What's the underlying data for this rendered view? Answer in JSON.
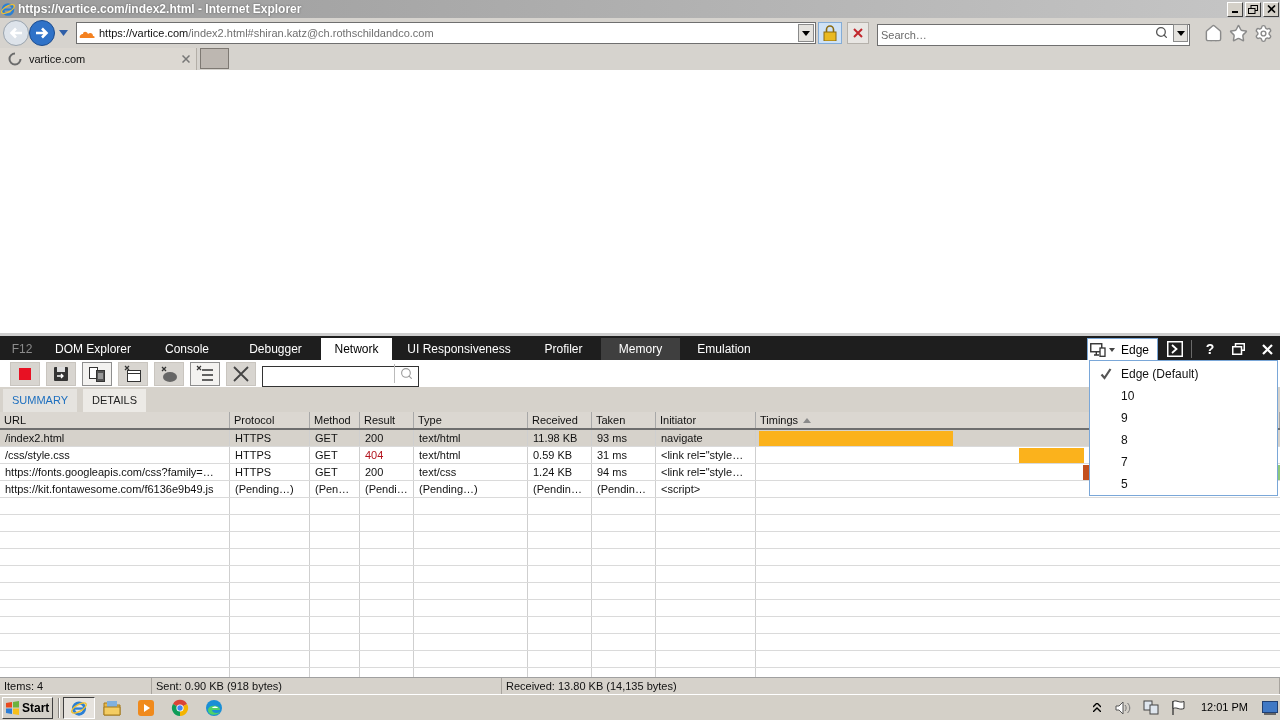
{
  "window": {
    "title": "https://vartice.com/index2.html - Internet Explorer"
  },
  "address_bar": {
    "back_enabled": false,
    "url_host": "https://vartice.com",
    "url_path": "/index2.html#shiran.katz@ch.rothschildandco.com"
  },
  "search": {
    "placeholder": "Search…"
  },
  "browser_tabs": [
    {
      "label": "vartice.com",
      "selected": true,
      "loading": true
    }
  ],
  "devtools": {
    "f12_label": "F12",
    "tabs": [
      {
        "label": "DOM Explorer",
        "selected": false,
        "hovered": false
      },
      {
        "label": "Console",
        "selected": false,
        "hovered": false
      },
      {
        "label": "Debugger",
        "selected": false,
        "hovered": false
      },
      {
        "label": "Network",
        "selected": true,
        "hovered": false
      },
      {
        "label": "UI Responsiveness",
        "selected": false,
        "hovered": false
      },
      {
        "label": "Profiler",
        "selected": false,
        "hovered": false
      },
      {
        "label": "Memory",
        "selected": false,
        "hovered": true
      },
      {
        "label": "Emulation",
        "selected": false,
        "hovered": false
      }
    ],
    "emulation": {
      "mode": "Edge",
      "menu_open": true,
      "options": [
        {
          "label": "Edge (Default)",
          "checked": true
        },
        {
          "label": "10",
          "checked": false
        },
        {
          "label": "9",
          "checked": false
        },
        {
          "label": "8",
          "checked": false
        },
        {
          "label": "7",
          "checked": false
        },
        {
          "label": "5",
          "checked": false
        }
      ]
    },
    "help_label": "?",
    "toolbar": {
      "buttons": [
        {
          "pressed": false
        },
        {
          "pressed": false
        },
        {
          "pressed": true
        },
        {
          "pressed": false
        },
        {
          "pressed": false
        },
        {
          "pressed": true
        },
        {
          "pressed": false
        }
      ]
    },
    "subtabs": [
      {
        "label": "SUMMARY",
        "selected": true
      },
      {
        "label": "DETAILS",
        "selected": false
      }
    ],
    "table": {
      "columns": [
        {
          "label": "URL",
          "sorted": false
        },
        {
          "label": "Protocol",
          "sorted": false
        },
        {
          "label": "Method",
          "sorted": false
        },
        {
          "label": "Result",
          "sorted": false
        },
        {
          "label": "Type",
          "sorted": false
        },
        {
          "label": "Received",
          "sorted": false
        },
        {
          "label": "Taken",
          "sorted": false
        },
        {
          "label": "Initiator",
          "sorted": false
        },
        {
          "label": "Timings",
          "sorted": true
        }
      ],
      "rows": [
        {
          "selected": true,
          "error": false,
          "cells": [
            "/index2.html",
            "HTTPS",
            "GET",
            "200",
            "text/html",
            "11.98 KB",
            "93 ms",
            "navigate"
          ]
        },
        {
          "selected": false,
          "error": true,
          "cells": [
            "/css/style.css",
            "HTTPS",
            "GET",
            "404",
            "text/html",
            "0.59 KB",
            "31 ms",
            "<link rel=\"style…"
          ]
        },
        {
          "selected": false,
          "error": false,
          "cells": [
            "https://fonts.googleapis.com/css?family=…",
            "HTTPS",
            "GET",
            "200",
            "text/css",
            "1.24 KB",
            "94 ms",
            "<link rel=\"style…"
          ]
        },
        {
          "selected": false,
          "error": false,
          "cells": [
            "https://kit.fontawesome.com/f6136e9b49.js",
            "(Pending…)",
            "(Pen…",
            "(Pendi…",
            "(Pending…)",
            "(Pendin…",
            "(Pendin…",
            "<script>"
          ]
        }
      ]
    },
    "status_bar": [
      "Items: 4",
      "Sent: 0.90 KB (918 bytes)",
      "Received: 13.80 KB (14,135 bytes)"
    ]
  },
  "taskbar": {
    "start_label": "Start",
    "apps": [
      {
        "active": true
      },
      {
        "active": false
      },
      {
        "active": false
      },
      {
        "active": false
      },
      {
        "active": false
      }
    ],
    "clock": "12:01 PM"
  }
}
